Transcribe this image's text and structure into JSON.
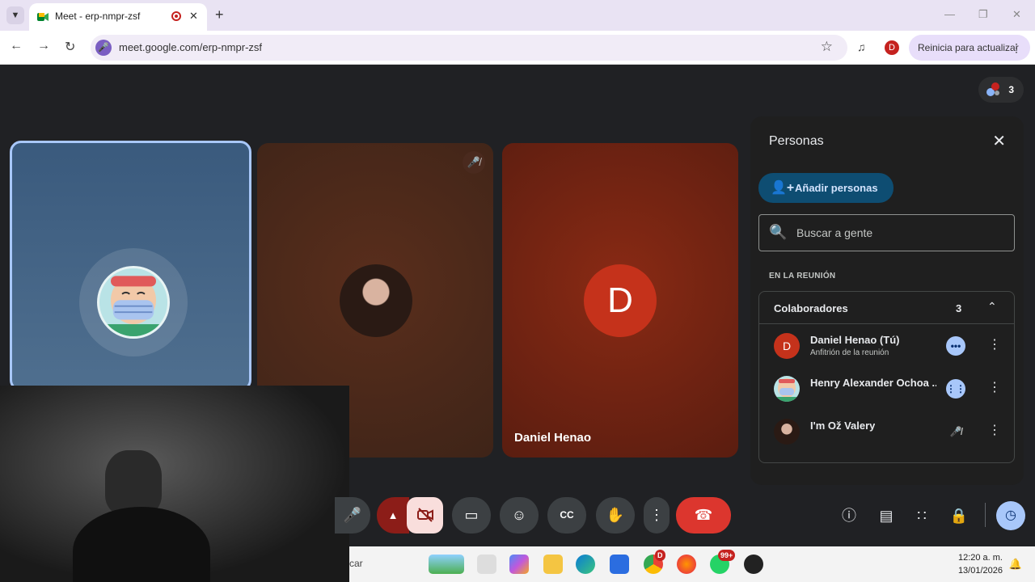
{
  "browser": {
    "tab_title": "Meet - erp-nmpr-zsf",
    "url": "meet.google.com/erp-nmpr-zsf",
    "profile_initial": "D",
    "update_button": "Reinicia para actualizar"
  },
  "meeting": {
    "participant_count": "3",
    "tiles": [
      {
        "name": "",
        "type": "avatar-image"
      },
      {
        "name": "",
        "type": "avatar-image",
        "muted": true
      },
      {
        "name": "Daniel Henao",
        "initial": "D"
      }
    ],
    "controls": [
      "microphone",
      "more-audio",
      "camera-off",
      "present",
      "emoji",
      "captions",
      "raise-hand",
      "more-options",
      "leave-call"
    ],
    "side_controls": [
      "info",
      "chat",
      "activities",
      "host-controls",
      "timer"
    ],
    "captions_label": "CC"
  },
  "people_panel": {
    "title": "Personas",
    "add_button": "Añadir personas",
    "search_placeholder": "Buscar a gente",
    "section_label": "EN LA REUNIÓN",
    "group": {
      "label": "Colaboradores",
      "count": "3"
    },
    "participants": [
      {
        "name": "Daniel Henao (Tú)",
        "role": "Anfitrión de la reunión",
        "initial": "D",
        "status": "more"
      },
      {
        "name": "Henry Alexander Ochoa ...",
        "role": "",
        "status": "speaking"
      },
      {
        "name": "I'm Ož Valery",
        "role": "",
        "status": "muted"
      }
    ]
  },
  "taskbar": {
    "search_fragment": "car",
    "chrome_badge": "D",
    "whatsapp_badge": "99+",
    "time": "12:20 a. m.",
    "date": "13/01/2026"
  },
  "colors": {
    "accent": "#a8c7fa",
    "leave": "#dc362e",
    "add_button": "#0e4d72"
  }
}
